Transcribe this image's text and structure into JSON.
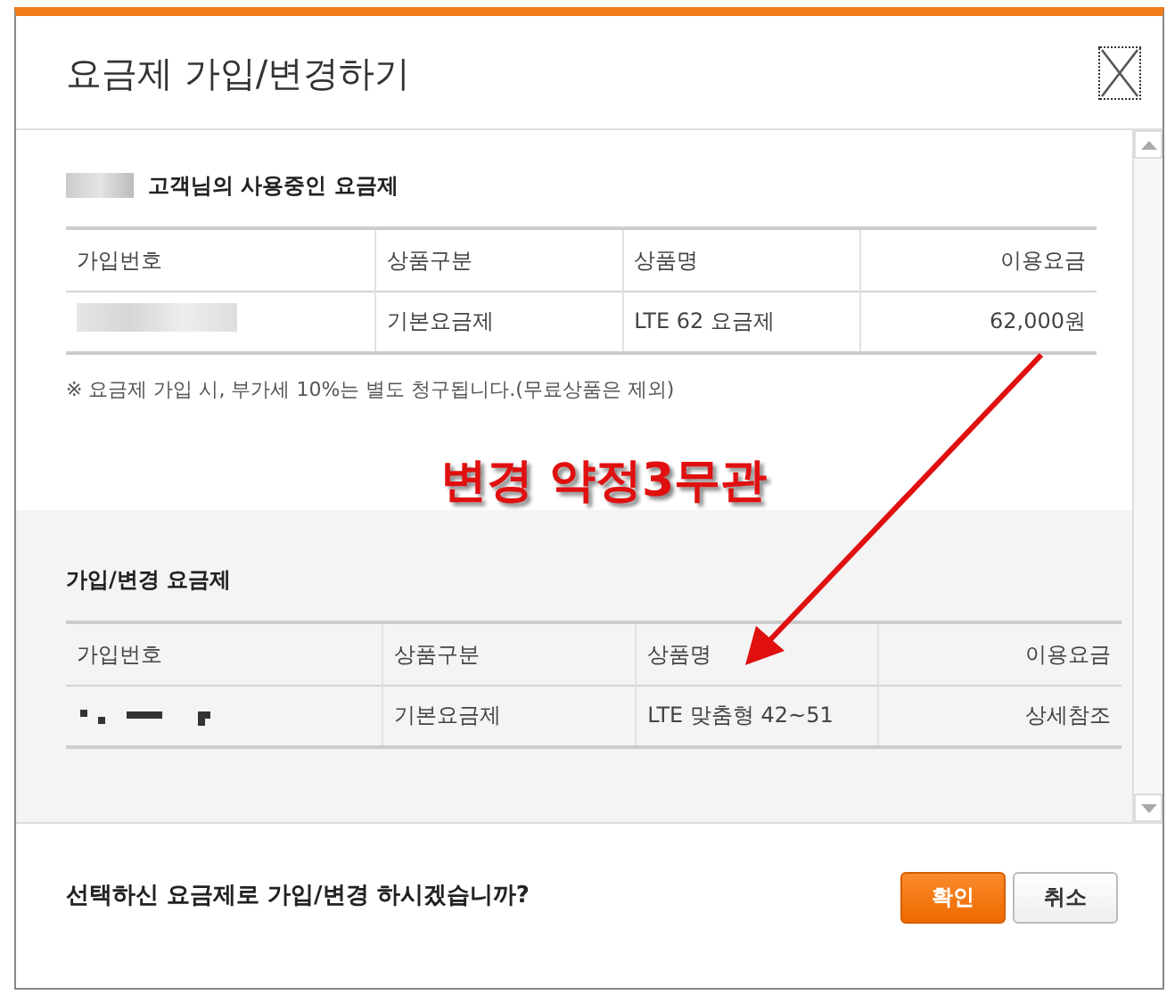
{
  "dialog": {
    "title": "요금제 가입/변경하기"
  },
  "current": {
    "heading": "고객님의 사용중인 요금제",
    "name_redacted": true,
    "columns": [
      "가입번호",
      "상품구분",
      "상품명",
      "이용요금"
    ],
    "rows": [
      {
        "number_redacted": true,
        "type": "기본요금제",
        "product": "LTE 62 요금제",
        "fee": "62,000원"
      }
    ],
    "note": "※  요금제 가입 시, 부가세 10%는 별도 청구됩니다.(무료상품은 제외)"
  },
  "annotation": {
    "text": "변경 약정3무관"
  },
  "new_plan": {
    "heading": "가입/변경 요금제",
    "columns": [
      "가입번호",
      "상품구분",
      "상품명",
      "이용요금"
    ],
    "rows": [
      {
        "number_redacted": true,
        "type": "기본요금제",
        "product": "LTE 맞춤형 42~51",
        "fee": "상세참조"
      }
    ]
  },
  "footer": {
    "question": "선택하신 요금제로 가입/변경 하시겠습니까?",
    "buttons": [
      {
        "label": "확인",
        "kind": "primary"
      },
      {
        "label": "취소",
        "kind": "secondary"
      }
    ]
  }
}
